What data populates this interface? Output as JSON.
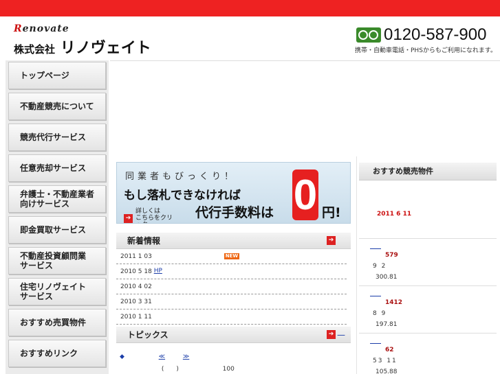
{
  "header": {
    "logo_en_mark": "R",
    "logo_en_rest": "enovate",
    "logo_jp_prefix": "株式会社",
    "logo_jp_name": "リノヴェイト",
    "phone": "0120-587-900",
    "phone_note": "携帯・自動車電話・PHSからもご利用になれます。"
  },
  "sidebar": {
    "items": [
      {
        "label": "トップページ"
      },
      {
        "label": "不動産競売について"
      },
      {
        "label": "競売代行サービス"
      },
      {
        "label": "任意売却サービス"
      },
      {
        "label": "弁護士・不動産業者\n向けサービス"
      },
      {
        "label": "即金買取サービス"
      },
      {
        "label": "不動産投資顧問業\nサービス"
      },
      {
        "label": "住宅リノヴェイト\nサービス"
      },
      {
        "label": "おすすめ売買物件"
      },
      {
        "label": "おすすめリンク"
      }
    ]
  },
  "banner": {
    "line1": "同業者もびっくり！",
    "line2": "もし落札できなければ",
    "line3": "代行手数料は",
    "zero": "0",
    "yen": "円!",
    "link_text": "詳しくは\nこちらをクリック",
    "arrow": "➔"
  },
  "news": {
    "title": "新着情報",
    "more_arrow": "➔",
    "new_badge": "NEW",
    "rows": [
      {
        "date": "2011 1 03",
        "link": "",
        "new": true
      },
      {
        "date": "2010 5 18",
        "link": "HP",
        "new": false
      },
      {
        "date": "2010 4 02",
        "link": "",
        "new": false
      },
      {
        "date": "2010 3 31",
        "link": "",
        "new": false
      },
      {
        "date": "2010 1 11",
        "link": "",
        "new": false
      }
    ]
  },
  "topics": {
    "title": "トピックス",
    "more_arrow": "➔",
    "more_dash": "—",
    "line_bullet": "◆",
    "line_mid": "≪",
    "line_end": "≫",
    "sub_paren": "(　　)",
    "sub_value": "100"
  },
  "recommend": {
    "title": "おすすめ競売物件",
    "date": "2011 6 11",
    "items": [
      {
        "price": "579",
        "line2": "9 2",
        "line3": "300.81"
      },
      {
        "price": "1412",
        "line2": "8 9",
        "line3": "197.81"
      },
      {
        "price": "62",
        "line2": "53 11",
        "line3": "105.88"
      }
    ]
  },
  "colors": {
    "accent_red": "#ee2222",
    "link_blue": "#1a3ca8",
    "freedial_green": "#3a8a2a"
  }
}
